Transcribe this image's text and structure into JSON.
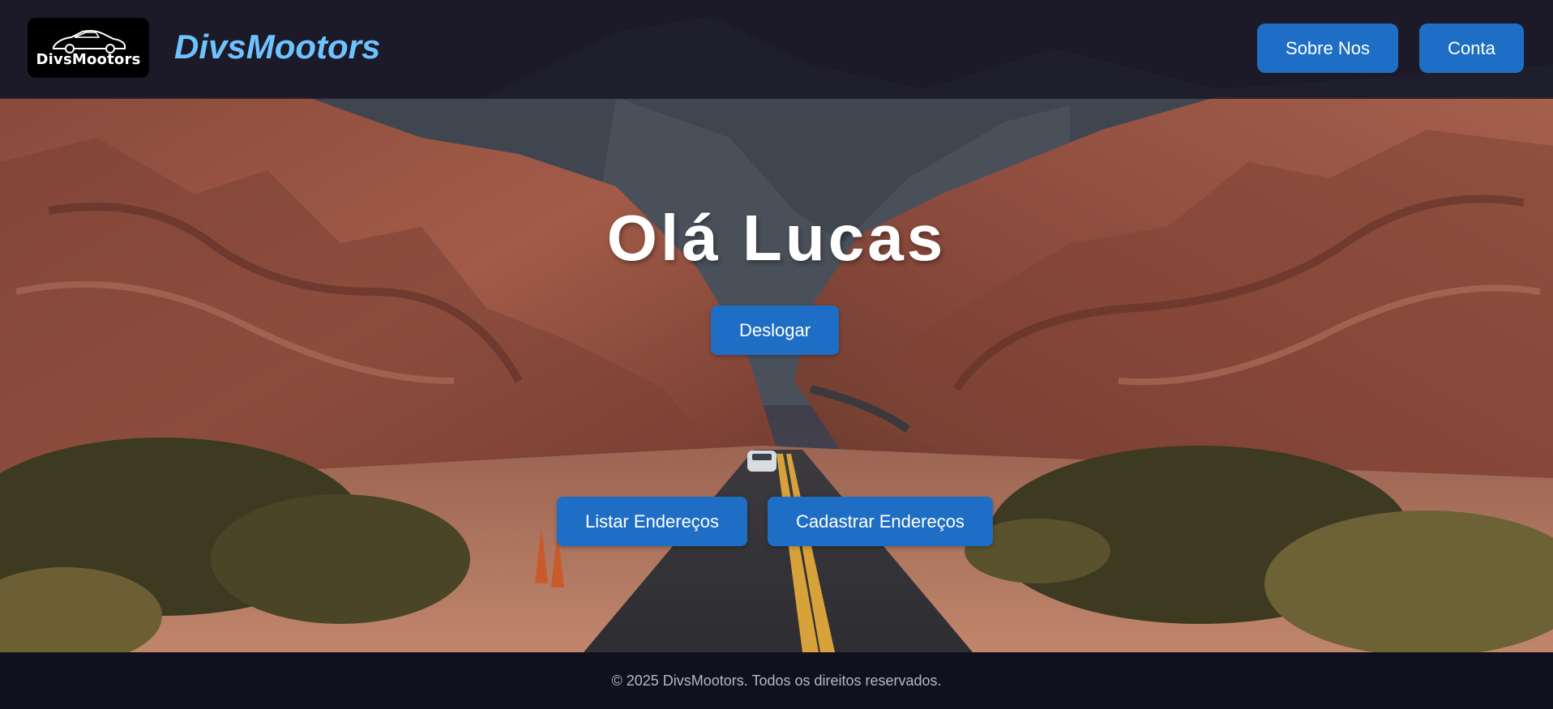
{
  "header": {
    "logo_text": "DivsMootors",
    "brand": "DivsMootors",
    "nav": [
      {
        "label": "Sobre Nos"
      },
      {
        "label": "Conta"
      }
    ]
  },
  "hero": {
    "greeting": "Olá Lucas",
    "logout_label": "Deslogar",
    "list_addresses_label": "Listar Endereços",
    "register_addresses_label": "Cadastrar Endereços",
    "background_icon": "desert-canyon-road-photo"
  },
  "footer": {
    "text": "© 2025 DivsMootors. Todos os direitos reservados."
  },
  "colors": {
    "primary_button": "#1f6ec6",
    "brand_text": "#6ec3ff",
    "header_bg": "#181624",
    "footer_bg": "#10101e"
  }
}
